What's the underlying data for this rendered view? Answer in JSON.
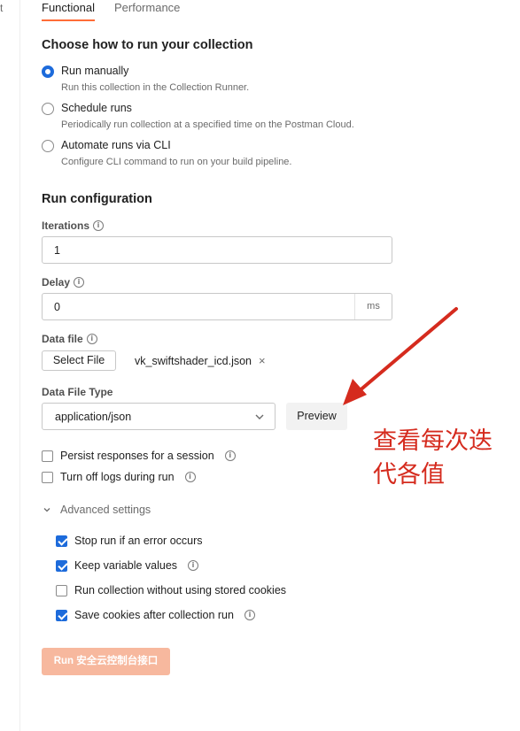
{
  "left_rail": {
    "fragment": "t"
  },
  "tabs": [
    {
      "label": "Functional",
      "active": true
    },
    {
      "label": "Performance",
      "active": false
    }
  ],
  "run_mode": {
    "heading": "Choose how to run your collection",
    "options": [
      {
        "label": "Run manually",
        "description": "Run this collection in the Collection Runner.",
        "selected": true
      },
      {
        "label": "Schedule runs",
        "description": "Periodically run collection at a specified time on the Postman Cloud.",
        "selected": false
      },
      {
        "label": "Automate runs via CLI",
        "description": "Configure CLI command to run on your build pipeline.",
        "selected": false
      }
    ]
  },
  "config": {
    "heading": "Run configuration",
    "iterations": {
      "label": "Iterations",
      "value": "1"
    },
    "delay": {
      "label": "Delay",
      "value": "0",
      "unit": "ms"
    },
    "data_file": {
      "label": "Data file",
      "select_label": "Select File",
      "file_name": "vk_swiftshader_icd.json",
      "remove_glyph": "×"
    },
    "data_file_type": {
      "label": "Data File Type",
      "value": "application/json",
      "preview_label": "Preview"
    },
    "checks": [
      {
        "label": "Persist responses for a session",
        "checked": false,
        "info": true
      },
      {
        "label": "Turn off logs during run",
        "checked": false,
        "info": true
      }
    ],
    "advanced": {
      "label": "Advanced settings",
      "items": [
        {
          "label": "Stop run if an error occurs",
          "checked": true,
          "info": false
        },
        {
          "label": "Keep variable values",
          "checked": true,
          "info": true
        },
        {
          "label": "Run collection without using stored cookies",
          "checked": false,
          "info": false
        },
        {
          "label": "Save cookies after collection run",
          "checked": true,
          "info": true
        }
      ]
    },
    "run_button": "Run 安全云控制台接口"
  },
  "annotation": {
    "text": "查看每次迭代各值",
    "color": "#d52b1e"
  },
  "colors": {
    "accent": "#ff6c37",
    "checkbox_blue": "#1d6bdb",
    "run_button": "#f7b89e"
  }
}
